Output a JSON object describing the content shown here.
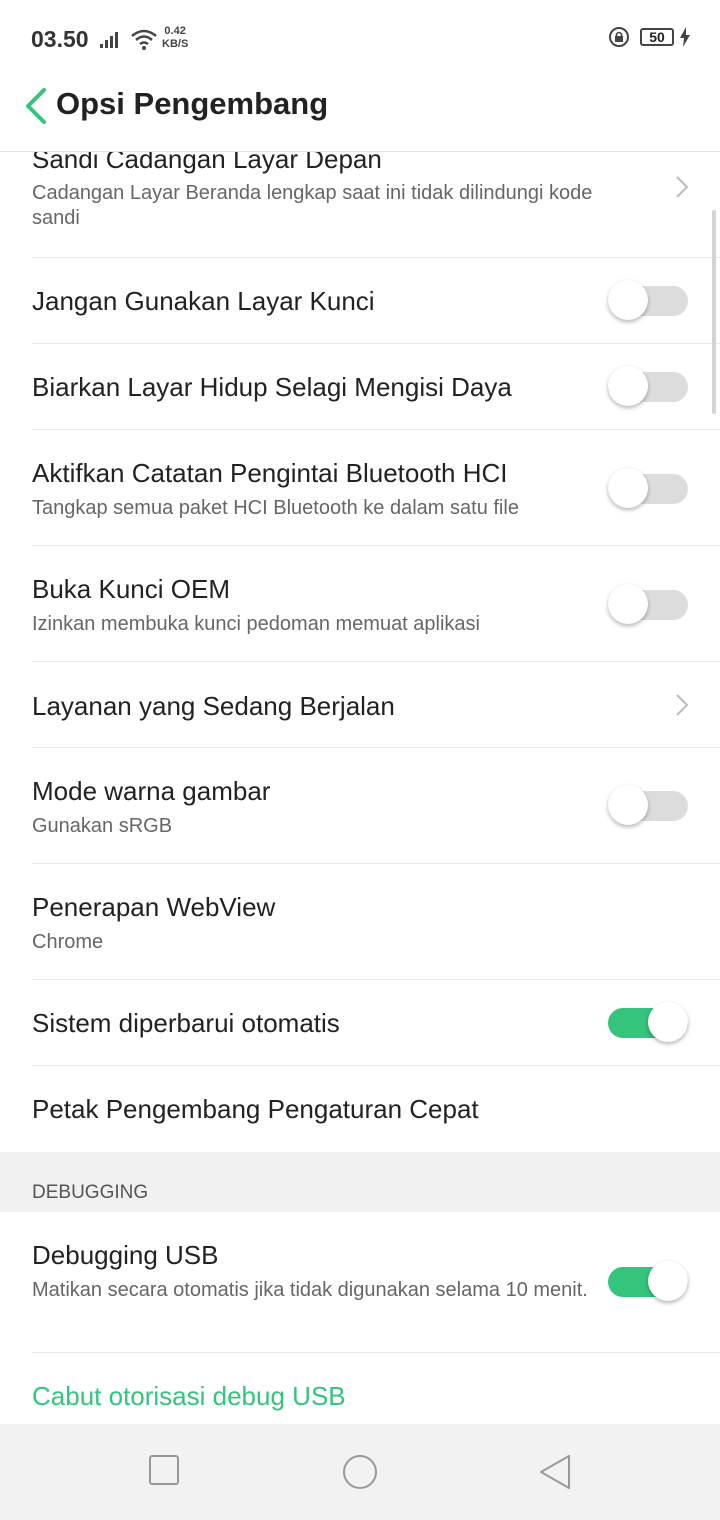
{
  "status_bar": {
    "time": "03.50",
    "speed_value": "0.42",
    "speed_unit": "KB/S",
    "battery": "50"
  },
  "header": {
    "title": "Opsi Pengembang"
  },
  "items": [
    {
      "title": "Sandi Cadangan Layar Depan",
      "subtitle": "Cadangan Layar Beranda lengkap saat ini tidak dilindungi kode sandi"
    },
    {
      "title": "Jangan Gunakan Layar Kunci",
      "toggle": false
    },
    {
      "title": "Biarkan Layar Hidup Selagi Mengisi Daya",
      "toggle": false
    },
    {
      "title": "Aktifkan Catatan Pengintai Bluetooth HCI",
      "subtitle": "Tangkap semua paket HCI Bluetooth ke dalam satu file",
      "toggle": false
    },
    {
      "title": "Buka Kunci OEM",
      "subtitle": "Izinkan membuka kunci pedoman memuat aplikasi",
      "toggle": false
    },
    {
      "title": "Layanan yang Sedang Berjalan"
    },
    {
      "title": "Mode warna gambar",
      "subtitle": "Gunakan sRGB",
      "toggle": false
    },
    {
      "title": "Penerapan WebView",
      "subtitle": "Chrome"
    },
    {
      "title": "Sistem diperbarui otomatis",
      "toggle": true
    },
    {
      "title": "Petak Pengembang Pengaturan Cepat"
    }
  ],
  "section_header": "DEBUGGING",
  "debug_items": [
    {
      "title": "Debugging USB",
      "subtitle": "Matikan secara otomatis jika tidak digunakan selama 10 menit.",
      "toggle": true
    },
    {
      "title": "Cabut otorisasi debug USB"
    }
  ],
  "colors": {
    "accent": "#34c47c",
    "link": "#34c47c",
    "toggle_off": "#dcdcdc"
  }
}
